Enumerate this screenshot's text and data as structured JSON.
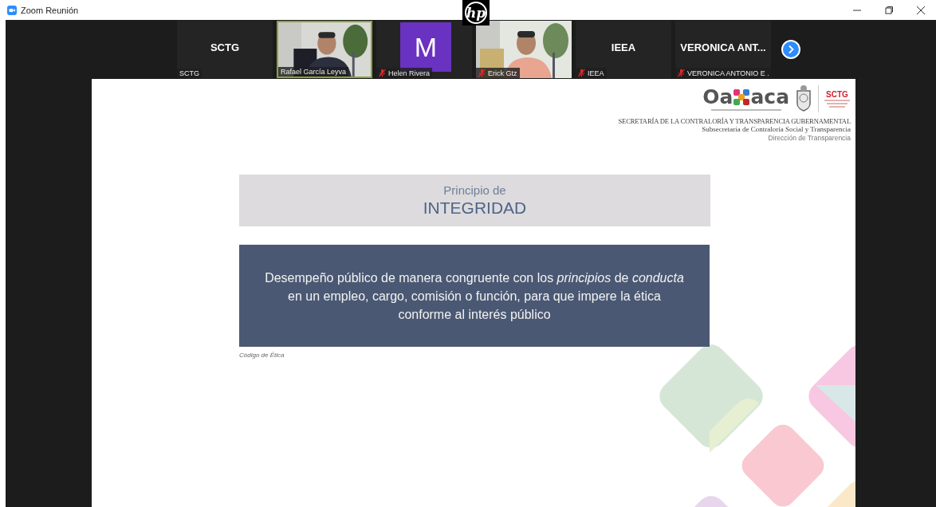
{
  "window": {
    "title": "Zoom Reunión"
  },
  "overlay_logo": {
    "text": "hp"
  },
  "participants": [
    {
      "kind": "name",
      "display": "SCTG",
      "label": "SCTG",
      "muted": false,
      "speaking": false
    },
    {
      "kind": "video",
      "label": "Rafael García Leyva",
      "muted": false,
      "speaking": true
    },
    {
      "kind": "avatar",
      "display": "M",
      "label": "Helen Rivera",
      "muted": true,
      "speaking": false
    },
    {
      "kind": "video",
      "label": "Erick Gtz",
      "muted": true,
      "speaking": false
    },
    {
      "kind": "name",
      "display": "IEEA",
      "label": "IEEA",
      "muted": true,
      "speaking": false
    },
    {
      "kind": "name",
      "display": "VERONICA  ANT...",
      "label": "VERONICA ANTONIO E .",
      "muted": true,
      "speaking": false
    }
  ],
  "slide": {
    "logo": {
      "wordmark_start": "Oa",
      "wordmark_end": "aca",
      "partner": "SCTG"
    },
    "header": [
      "SECRETARÍA DE LA CONTRALORÍA Y TRANSPARENCIA GUBERNAMENTAL",
      "Subsecretaria de Contraloría Social y Transparencia",
      "Dirección de Transparencia"
    ],
    "title_small": "Principio de",
    "title_large": "INTEGRIDAD",
    "definition": "Desempeño público de manera congruente con los *principios* de *conducta* en un empleo, cargo, comisión o función, para que impere la ética conforme al interés público",
    "source": "Código de Ética"
  }
}
